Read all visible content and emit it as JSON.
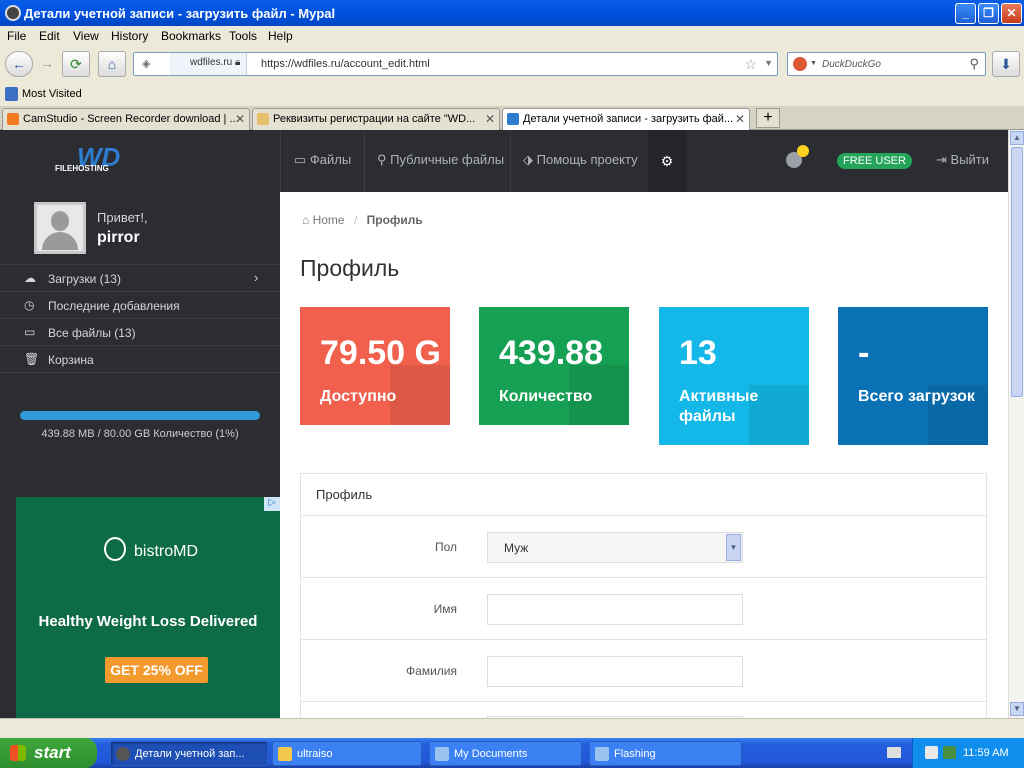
{
  "window": {
    "title": "Детали учетной записи - загрузить файл - Mypal"
  },
  "menu": [
    "File",
    "Edit",
    "View",
    "History",
    "Bookmarks",
    "Tools",
    "Help"
  ],
  "nav": {
    "site_label": "wdfiles.ru",
    "url": "https://wdfiles.ru/account_edit.html",
    "search_placeholder": "DuckDuckGo"
  },
  "bookmarks": {
    "most_visited": "Most Visited"
  },
  "tabs": [
    {
      "label": "CamStudio - Screen Recorder download | ...",
      "icon_color": "#F47B20"
    },
    {
      "label": "Реквизиты регистрации на сайте \"WD...",
      "icon_color": "#E6C06A"
    },
    {
      "label": "Детали учетной записи - загрузить фай...",
      "icon_color": "#2D7CD0"
    }
  ],
  "site": {
    "logo_wd": "WD",
    "logo_sub": "FILEHOSTING",
    "topnav": {
      "files": "Файлы",
      "public": "Публичные файлы",
      "help": "Помощь проекту",
      "free_user": "FREE USER",
      "logout": "Выйти"
    },
    "sidebar": {
      "greeting": "Привет!,",
      "username": "pirror",
      "items": [
        {
          "label": "Загрузки (13)"
        },
        {
          "label": "Последние добавления"
        },
        {
          "label": "Все файлы (13)"
        },
        {
          "label": "Корзина"
        }
      ],
      "storage_text": "439.88 MB / 80.00 GB Количество (1%)",
      "storage_fraction": 0.01
    },
    "ad": {
      "brand": "bistroMD",
      "headline": "Healthy Weight Loss Delivered",
      "cta": "GET 25% OFF",
      "colors": {
        "bg": "#0E6B47",
        "cta": "#F29A2E"
      }
    },
    "breadcrumb": {
      "home": "Home",
      "sep": "/",
      "current": "Профиль"
    },
    "page_title": "Профиль",
    "cards": [
      {
        "value": "79.50 G",
        "label": "Доступно",
        "color": "#F0604D"
      },
      {
        "value": "439.88",
        "label": "Количество",
        "color": "#16A054"
      },
      {
        "value": "13",
        "label": "Активные файлы",
        "color": "#13B8E8"
      },
      {
        "value": "-",
        "label": "Всего загрузок",
        "color": "#0B71B5"
      }
    ],
    "profile_panel": {
      "title": "Профиль",
      "fields": [
        {
          "label": "Пол",
          "value": "Муж"
        },
        {
          "label": "Имя",
          "value": ""
        },
        {
          "label": "Фамилия",
          "value": ""
        }
      ]
    }
  },
  "taskbar": {
    "start": "start",
    "items": [
      {
        "label": "Детали учетной зап..."
      },
      {
        "label": "ultraiso"
      },
      {
        "label": "My Documents"
      },
      {
        "label": "Flashing"
      }
    ],
    "clock": "11:59 AM"
  }
}
